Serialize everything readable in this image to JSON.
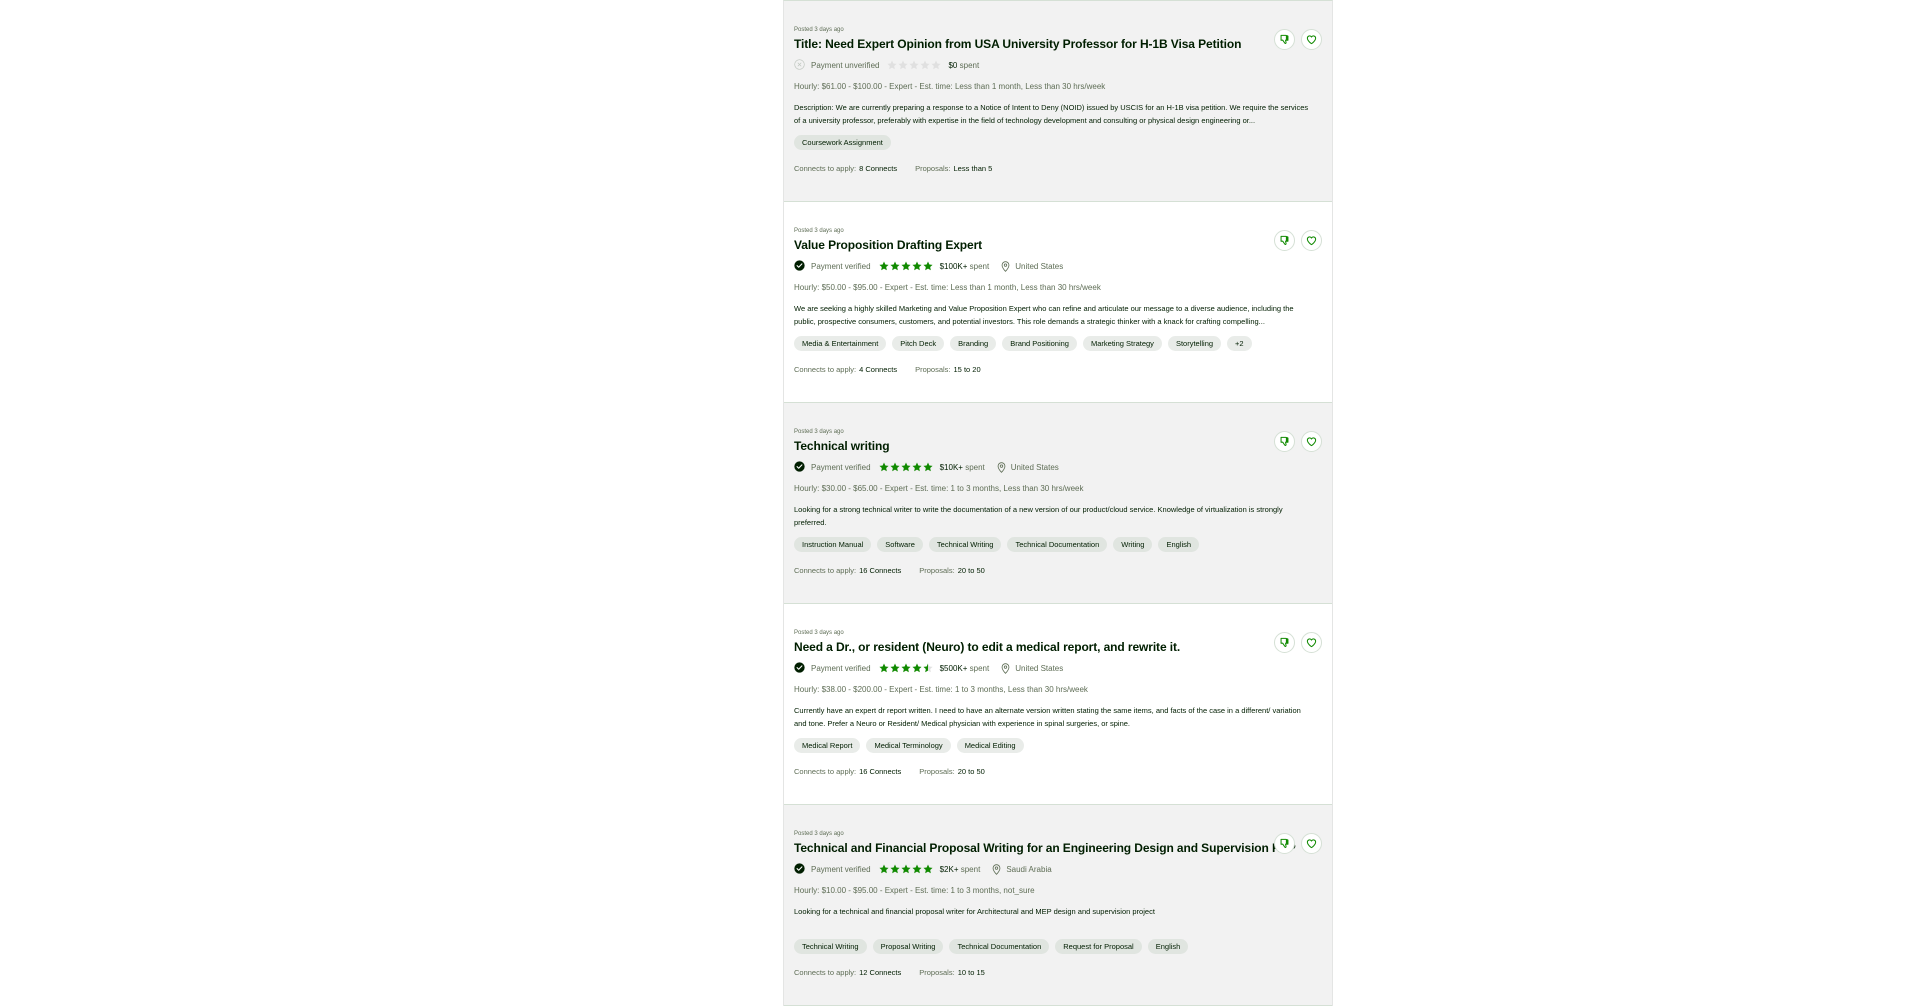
{
  "jobs": [
    {
      "posted": "Posted 3 days ago",
      "title": "Title: Need Expert Opinion from USA University Professor for H-1B Visa Petition",
      "payment_verified": false,
      "payment_label": "Payment unverified",
      "rating": 0,
      "spent_amount": "$0",
      "spent_label": "spent",
      "location": "",
      "terms": "Hourly: $61.00 - $100.00 - Expert - Est. time: Less than 1 month, Less than 30 hrs/week",
      "description": "Description: We are currently preparing a response to a Notice of Intent to Deny (NOID) issued by USCIS for an H-1B visa petition. We require the services of a university professor, preferably with expertise in the field of technology development and consulting or physical design engineering or...",
      "skills": [
        "Coursework Assignment"
      ],
      "connects_label": "Connects to apply:",
      "connects": "8 Connects",
      "proposals_label": "Proposals:",
      "proposals": "Less than 5"
    },
    {
      "posted": "Posted 3 days ago",
      "title": "Value Proposition Drafting Expert",
      "payment_verified": true,
      "payment_label": "Payment verified",
      "rating": 5,
      "spent_amount": "$100K+",
      "spent_label": "spent",
      "location": "United States",
      "terms": "Hourly: $50.00 - $95.00 - Expert - Est. time: Less than 1 month, Less than 30 hrs/week",
      "description": "We are seeking a highly skilled Marketing and Value Proposition Expert who can refine and articulate our message to a diverse audience, including the public, prospective consumers, customers, and potential investors. This role demands a strategic thinker with a knack for crafting compelling...",
      "skills": [
        "Media & Entertainment",
        "Pitch Deck",
        "Branding",
        "Brand Positioning",
        "Marketing Strategy",
        "Storytelling",
        "+2"
      ],
      "connects_label": "Connects to apply:",
      "connects": "4 Connects",
      "proposals_label": "Proposals:",
      "proposals": "15 to 20"
    },
    {
      "posted": "Posted 3 days ago",
      "title": "Technical writing",
      "payment_verified": true,
      "payment_label": "Payment verified",
      "rating": 5,
      "spent_amount": "$10K+",
      "spent_label": "spent",
      "location": "United States",
      "terms": "Hourly: $30.00 - $65.00 - Expert - Est. time: 1 to 3 months, Less than 30 hrs/week",
      "description": "Looking for a strong technical writer to write the documentation of a new version of our product/cloud service. Knowledge of virtualization is strongly preferred.",
      "skills": [
        "Instruction Manual",
        "Software",
        "Technical Writing",
        "Technical Documentation",
        "Writing",
        "English"
      ],
      "connects_label": "Connects to apply:",
      "connects": "16 Connects",
      "proposals_label": "Proposals:",
      "proposals": "20 to 50"
    },
    {
      "posted": "Posted 3 days ago",
      "title": "Need a Dr., or resident (Neuro) to edit a medical report, and rewrite it.",
      "payment_verified": true,
      "payment_label": "Payment verified",
      "rating": 4.5,
      "spent_amount": "$500K+",
      "spent_label": "spent",
      "location": "United States",
      "terms": "Hourly: $38.00 - $200.00 - Expert - Est. time: 1 to 3 months, Less than 30 hrs/week",
      "description": "Currently have an expert dr report written. I need to have an alternate version written stating the same items, and facts of the case in a different/ variation and tone. Prefer a Neuro or Resident/ Medical physician with experience in spinal surgeries, or spine.",
      "skills": [
        "Medical Report",
        "Medical Terminology",
        "Medical Editing"
      ],
      "connects_label": "Connects to apply:",
      "connects": "16 Connects",
      "proposals_label": "Proposals:",
      "proposals": "20 to 50"
    },
    {
      "posted": "Posted 3 days ago",
      "title": "Technical and Financial Proposal Writing for an Engineering Design and Supervision RFP",
      "payment_verified": true,
      "payment_label": "Payment verified",
      "rating": 5,
      "spent_amount": "$2K+",
      "spent_label": "spent",
      "location": "Saudi Arabia",
      "terms": "Hourly: $10.00 - $95.00 - Expert - Est. time: 1 to 3 months, not_sure",
      "description": "Looking for a technical and financial proposal writer for Architectural and MEP design and supervision project",
      "skills": [
        "Technical Writing",
        "Proposal Writing",
        "Technical Documentation",
        "Request for Proposal",
        "English"
      ],
      "connects_label": "Connects to apply:",
      "connects": "12 Connects",
      "proposals_label": "Proposals:",
      "proposals": "10 to 15"
    }
  ],
  "colors": {
    "accent": "#108a00",
    "star_empty": "#e0e0e0",
    "verified_badge": "#001e00"
  },
  "icons": {
    "dislike": "thumbs-down-icon",
    "save": "heart-icon",
    "verified": "check-badge-icon",
    "location": "location-pin-icon",
    "star": "star-icon"
  }
}
